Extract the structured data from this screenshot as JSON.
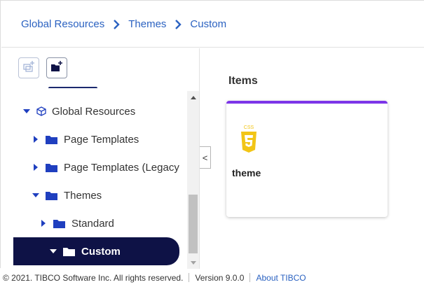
{
  "breadcrumb": {
    "items": [
      "Global Resources",
      "Themes",
      "Custom"
    ]
  },
  "toolbar": {
    "new_item_icon": "add-item-icon",
    "new_folder_icon": "add-folder-icon"
  },
  "tree": {
    "items": [
      {
        "label": "Global Resources",
        "expanded": true,
        "icon": "cube-icon"
      },
      {
        "label": "Page Templates",
        "expanded": false,
        "icon": "folder-icon"
      },
      {
        "label": "Page Templates (Legacy",
        "expanded": false,
        "icon": "folder-icon"
      },
      {
        "label": "Themes",
        "expanded": true,
        "icon": "folder-icon"
      },
      {
        "label": "Standard",
        "expanded": false,
        "icon": "folder-icon"
      },
      {
        "label": "Custom",
        "expanded": true,
        "icon": "folder-icon",
        "selected": true
      }
    ]
  },
  "collapse_glyph": "<",
  "main": {
    "section_title": "Items",
    "card": {
      "label": "theme",
      "icon_text": "CSS",
      "icon": "css3-icon"
    }
  },
  "footer": {
    "copyright": "© 2021. TIBCO Software Inc. All rights reserved.",
    "version": "Version 9.0.0",
    "about_link": "About TIBCO"
  },
  "colors": {
    "link": "#2b62c1",
    "selected_bg": "#0e1246",
    "folder": "#1f3fbf",
    "card_accent": "#7c35e8",
    "css_badge": "#f2c516"
  }
}
